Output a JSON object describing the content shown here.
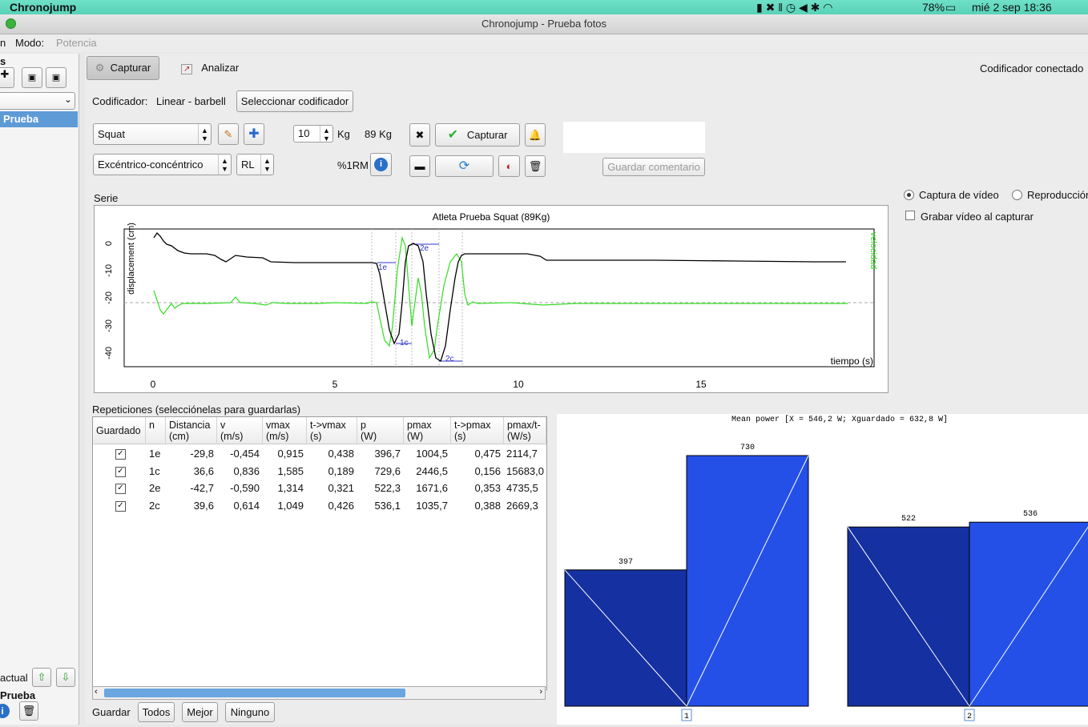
{
  "menubar": {
    "app_name": "Chronojump",
    "battery": "78%",
    "datetime": "mié 2 sep  18:36"
  },
  "window": {
    "title": "Chronojump - Prueba fotos"
  },
  "mode": {
    "label": "Modo:",
    "value": "Potencia"
  },
  "sidebar": {
    "header": "s",
    "selected_person": "Prueba",
    "current_label": "actual",
    "current_person": "Prueba"
  },
  "tabs": {
    "capture": "Capturar",
    "analyze": "Analizar"
  },
  "encoder_status": "Codificador conectado",
  "encoder": {
    "label": "Codificador:",
    "value": "Linear - barbell",
    "select_button": "Seleccionar codificador"
  },
  "exercise": {
    "value": "Squat"
  },
  "contraction": {
    "value": "Excéntrico-concéntrico"
  },
  "laterality": {
    "value": "RL"
  },
  "weight": {
    "value": "10",
    "unit": "Kg",
    "total": "89 Kg"
  },
  "rm_label": "%1RM",
  "capture_button": "Capturar",
  "save_comment_button": "Guardar comentario",
  "video": {
    "capture_option": "Captura de vídeo",
    "playback_option": "Reproducción",
    "record_checkbox": "Grabar vídeo al capturar"
  },
  "serie_label": "Serie",
  "graph": {
    "title": "Atleta Prueba     Squat     (89Kg)",
    "ylabel": "displacement (cm)",
    "ylabel_right": "velocidad",
    "xlabel": "tiempo (s)",
    "xticks": [
      "0",
      "5",
      "10",
      "15"
    ],
    "yticks": [
      "0",
      "-10",
      "-20",
      "-30",
      "-40"
    ],
    "phase_labels": [
      "1e",
      "1c",
      "2e",
      "2c"
    ],
    "colors": {
      "displacement": "#000000",
      "velocity": "#33dd22",
      "phase": "#3333cc"
    }
  },
  "repetitions": {
    "title": "Repeticiones (selecciónelas para guardarlas)",
    "headers": [
      "Guardado",
      "n",
      "Distancia\n(cm)",
      "v\n(m/s)",
      "vmax\n(m/s)",
      "t->vmax\n(s)",
      "p\n(W)",
      "pmax\n(W)",
      "t->pmax\n(s)",
      "pmax/t-\n(W/s)"
    ],
    "rows": [
      {
        "saved": true,
        "n": "1e",
        "dist": "-29,8",
        "v": "-0,454",
        "vmax": "0,915",
        "tvmax": "0,438",
        "p": "396,7",
        "pmax": "1004,5",
        "tpmax": "0,475",
        "pmaxt": "2114,7"
      },
      {
        "saved": true,
        "n": "1c",
        "dist": "36,6",
        "v": "0,836",
        "vmax": "1,585",
        "tvmax": "0,189",
        "p": "729,6",
        "pmax": "2446,5",
        "tpmax": "0,156",
        "pmaxt": "15683,0"
      },
      {
        "saved": true,
        "n": "2e",
        "dist": "-42,7",
        "v": "-0,590",
        "vmax": "1,314",
        "tvmax": "0,321",
        "p": "522,3",
        "pmax": "1671,6",
        "tpmax": "0,353",
        "pmaxt": "4735,5"
      },
      {
        "saved": true,
        "n": "2c",
        "dist": "39,6",
        "v": "0,614",
        "vmax": "1,049",
        "tvmax": "0,426",
        "p": "536,1",
        "pmax": "1035,7",
        "tpmax": "0,388",
        "pmaxt": "2669,3"
      }
    ]
  },
  "bottom_buttons": {
    "save_label": "Guardar",
    "all": "Todos",
    "best": "Mejor",
    "none": "Ninguno"
  },
  "chart_data": {
    "type": "bar",
    "title": "Mean power [X = 546,2 W; Xguardado = 632,8 W]",
    "categories": [
      "1",
      "2"
    ],
    "series": [
      {
        "values": [
          397,
          522
        ]
      },
      {
        "values": [
          730,
          536
        ]
      }
    ],
    "value_labels": [
      "397",
      "730",
      "522",
      "536"
    ],
    "colors": [
      "#1530a0",
      "#2450e8"
    ],
    "ylim": [
      0,
      800
    ]
  }
}
